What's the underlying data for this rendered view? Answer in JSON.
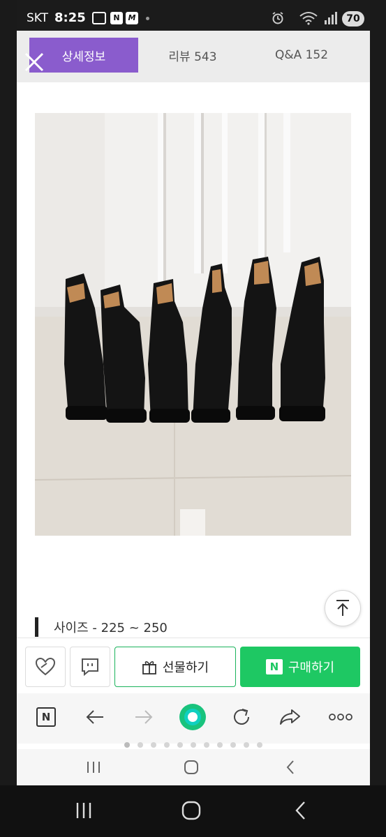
{
  "status_bar": {
    "carrier": "SKT",
    "time": "8:25",
    "battery": "70",
    "notif_n": "N",
    "notif_m": "M"
  },
  "tabs": [
    {
      "label": "상세정보",
      "active": true
    },
    {
      "label": "리뷰  543",
      "active": false
    },
    {
      "label": "Q&A  152",
      "active": false
    }
  ],
  "product": {
    "image_description_icon": "boots-photo",
    "size_text": "사이즈 - 225 ~ 250"
  },
  "actions": {
    "gift_label": "선물하기",
    "buy_label": "구매하기",
    "npay_badge": "N"
  },
  "browser_toolbar": {
    "naver_badge": "N"
  },
  "colors": {
    "tab_active": "#8a5ccd",
    "buy_green": "#1ec863",
    "gift_border": "#1ab35b"
  }
}
